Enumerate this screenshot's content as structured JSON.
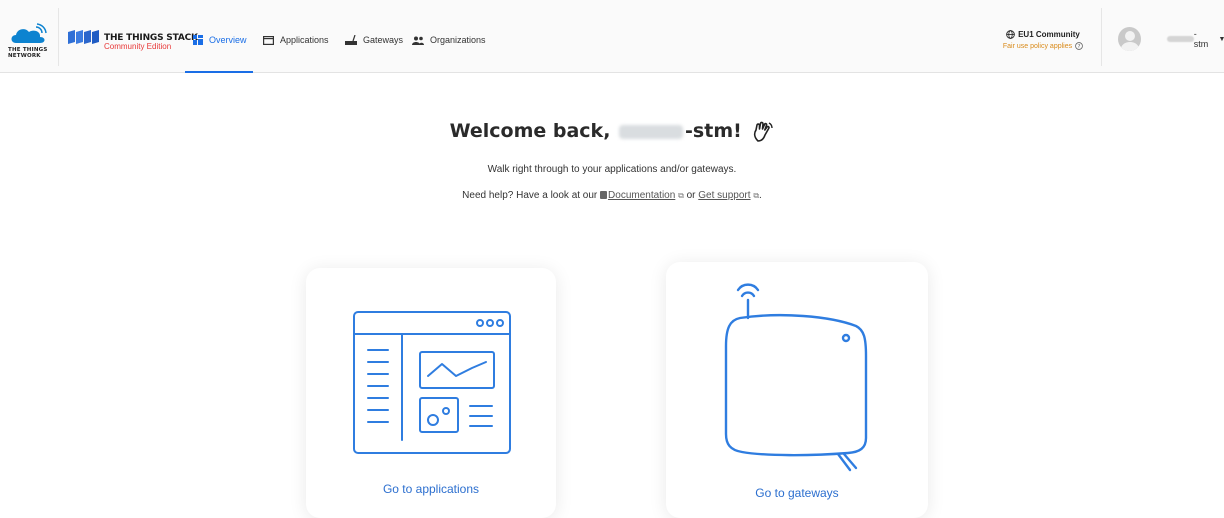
{
  "header": {
    "ttn_logo_text": "THE THINGS NETWORK",
    "ttn_logo_line1": "THE THINGS",
    "ttn_logo_line2": "NETWORK",
    "brand_title": "THE THINGS STACK",
    "brand_subtitle": "Community Edition",
    "nav": [
      {
        "label": "Overview",
        "icon": "overview-icon",
        "active": true
      },
      {
        "label": "Applications",
        "icon": "application-icon",
        "active": false
      },
      {
        "label": "Gateways",
        "icon": "gateway-icon",
        "active": false
      },
      {
        "label": "Organizations",
        "icon": "organization-icon",
        "active": false
      }
    ],
    "cluster": {
      "name": "EU1 Community",
      "note": "Fair use policy applies"
    },
    "user": {
      "name_suffix": "-stm"
    }
  },
  "main": {
    "welcome_prefix": "Welcome back,",
    "welcome_suffix": "-stm!",
    "subtitle": "Walk right through to your applications and/or gateways.",
    "help_prefix": "Need help? Have a look at our",
    "help_doc_link": "Documentation",
    "help_or": "or",
    "help_support_link": "Get support",
    "help_end": "."
  },
  "cards": {
    "applications_label": "Go to applications",
    "gateways_label": "Go to gateways"
  },
  "colors": {
    "accent": "#1a6ee6",
    "illustration": "#2f7de0",
    "brand_red": "#e83838",
    "fair_use": "#d98a19"
  }
}
